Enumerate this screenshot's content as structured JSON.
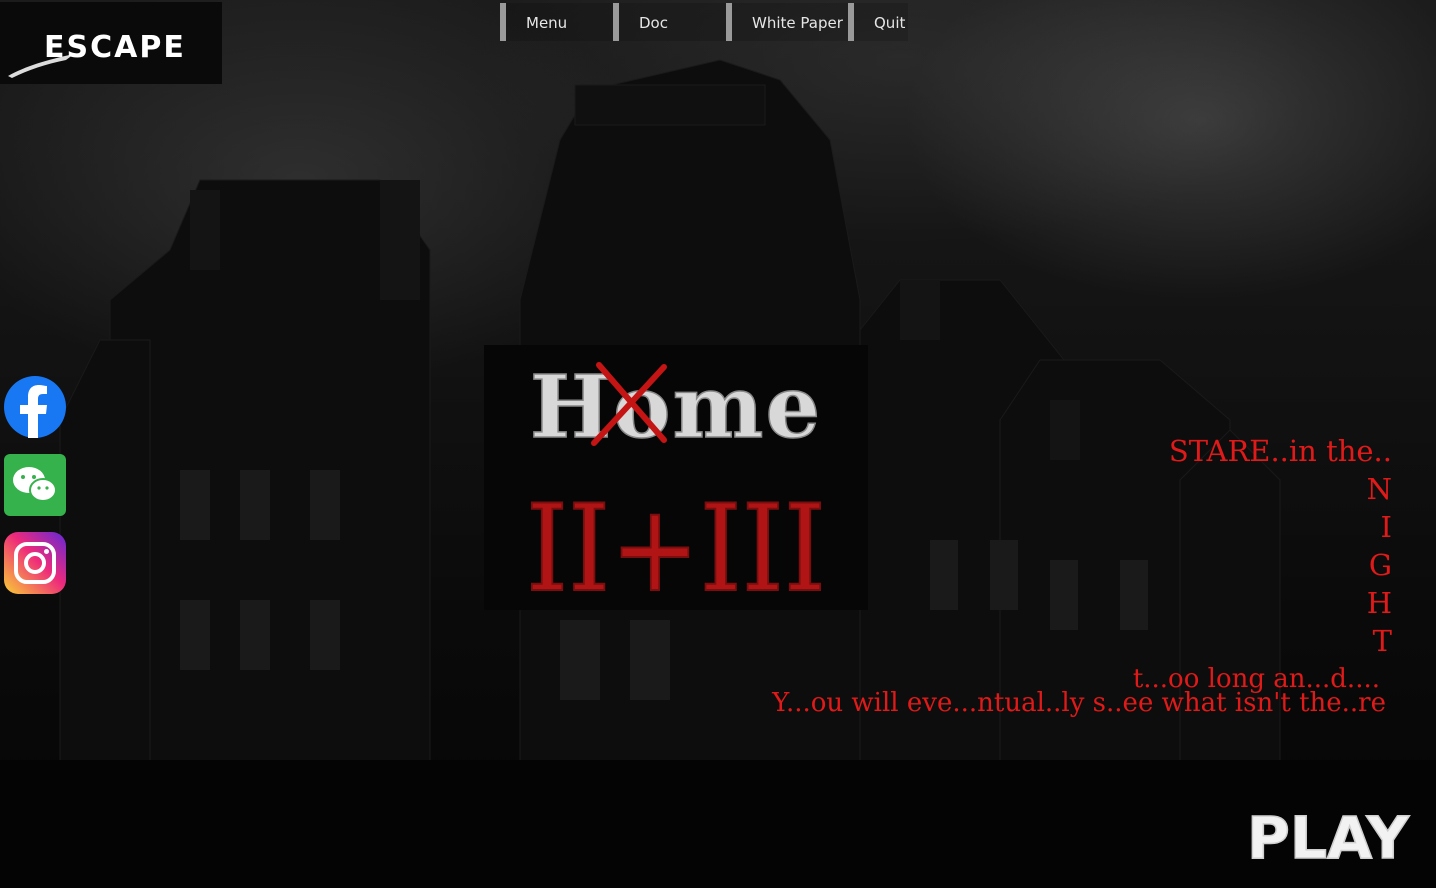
{
  "brand": {
    "name": "ESCAPE"
  },
  "nav": {
    "items": [
      "Menu",
      "Doc",
      "White Paper",
      "Quit"
    ]
  },
  "title": {
    "word": "Home",
    "numeral": "II+III"
  },
  "social": {
    "facebook_icon": "facebook-icon",
    "wechat_icon": "wechat-icon",
    "instagram_icon": "instagram-icon"
  },
  "tagline": {
    "line1": "STARE..in the..",
    "letters": [
      "N",
      "I",
      "G",
      "H",
      "T"
    ],
    "line2": "t...oo long an...d....",
    "line3": "Y...ou will eve...ntual..ly s..ee what isn't the..re"
  },
  "play": {
    "label": "PLAY"
  },
  "colors": {
    "accent_red": "#e01919",
    "nav_bar": "#9a9a9a"
  }
}
